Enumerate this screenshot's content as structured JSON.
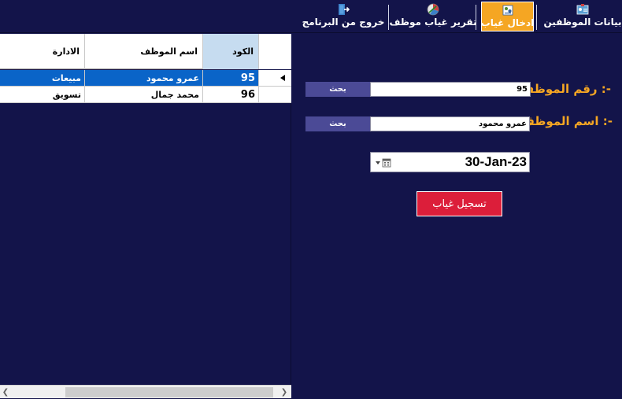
{
  "menu": {
    "items": [
      {
        "label": "بيانات الموظفين",
        "icon": "employee-card-icon"
      },
      {
        "label": "ادخال غياب",
        "icon": "absence-entry-icon",
        "active": true
      },
      {
        "label": "تقرير غياب موظف",
        "icon": "report-chart-icon"
      },
      {
        "label": "خروج من البرنامج",
        "icon": "exit-door-icon"
      }
    ]
  },
  "grid": {
    "headers": {
      "code": "الكود",
      "name": "اسم الموظف",
      "department": "الادارة"
    },
    "rows": [
      {
        "code": "95",
        "name": "عمرو محمود",
        "department": "مبيعات",
        "selected": true
      },
      {
        "code": "96",
        "name": "محمد جمال",
        "department": "تسويق",
        "selected": false
      }
    ]
  },
  "form": {
    "employee_number_label": "رقم الموظف :-",
    "employee_number_value": "95",
    "employee_name_label": "اسم الموظف :-",
    "employee_name_value": "عمرو محمود",
    "search_label": "بحث",
    "date_value": "30-Jan-23",
    "submit_label": "تسجيل غياب"
  },
  "colors": {
    "background": "#13144a",
    "accent": "#f5a623",
    "selection": "#0a64c8",
    "submit": "#dc1e3a",
    "search_button": "#4b4a96"
  }
}
